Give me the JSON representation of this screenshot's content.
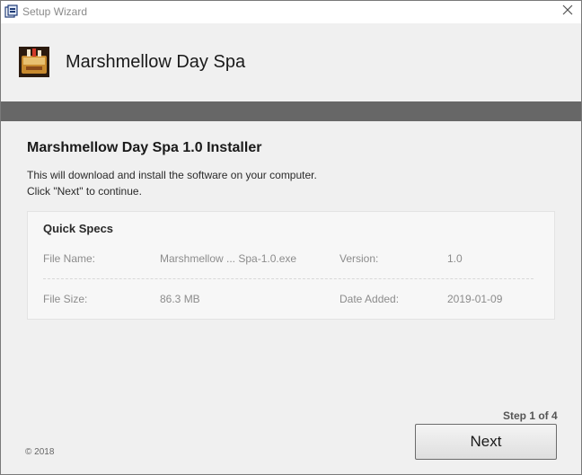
{
  "window": {
    "title": "Setup Wizard",
    "title_icon": "installer-icon",
    "close_icon": "close-icon"
  },
  "header": {
    "app_name": "Marshmellow Day Spa",
    "logo": "app-logo-icon",
    "band_color": "#676767"
  },
  "main": {
    "installer_title": "Marshmellow Day Spa 1.0 Installer",
    "description_line1": "This will download and install the software on your computer.",
    "description_line2": "Click \"Next\" to continue."
  },
  "specs": {
    "title": "Quick Specs",
    "file_name_label": "File Name:",
    "file_name_value": "Marshmellow ... Spa-1.0.exe",
    "version_label": "Version:",
    "version_value": "1.0",
    "file_size_label": "File Size:",
    "file_size_value": "86.3 MB",
    "date_added_label": "Date Added:",
    "date_added_value": "2019-01-09"
  },
  "footer": {
    "copyright": "© 2018",
    "step": "Step 1 of 4",
    "next_label": "Next"
  }
}
